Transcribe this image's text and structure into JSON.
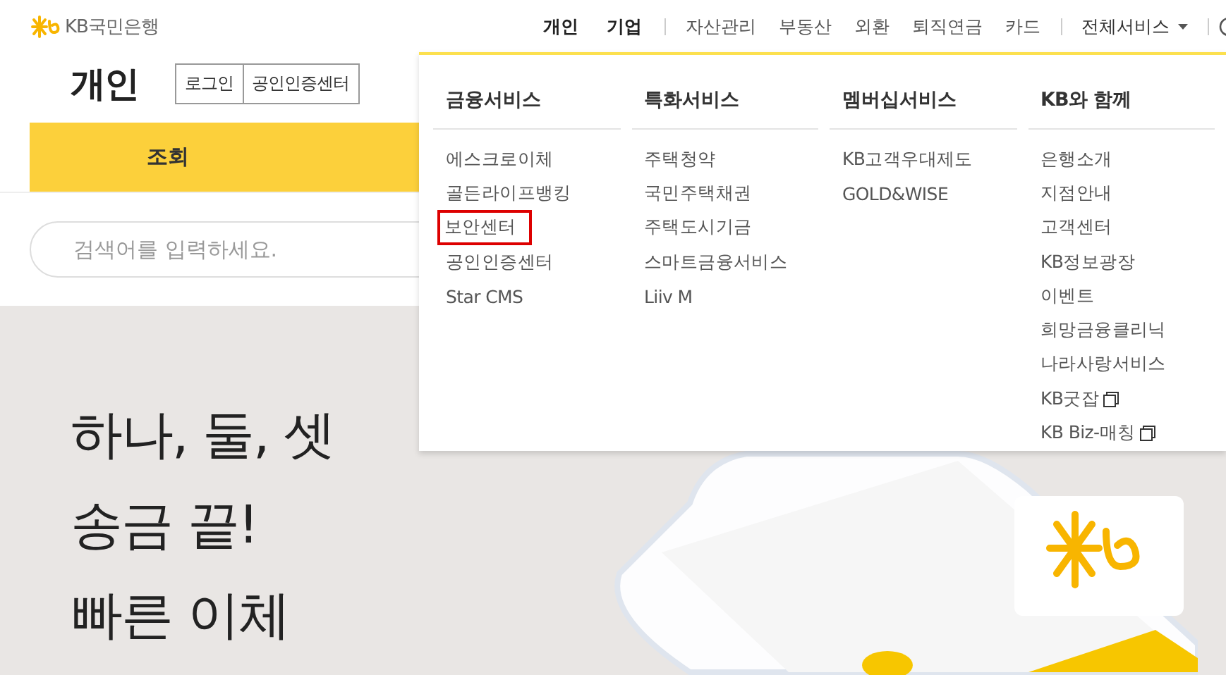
{
  "header": {
    "logo": "KB국민은행",
    "nav": [
      {
        "label": "개인",
        "kind": "primary"
      },
      {
        "label": "기업",
        "kind": "primary"
      },
      {
        "label": "자산관리",
        "kind": "secondary"
      },
      {
        "label": "부동산",
        "kind": "secondary"
      },
      {
        "label": "외환",
        "kind": "secondary"
      },
      {
        "label": "퇴직연금",
        "kind": "secondary"
      },
      {
        "label": "카드",
        "kind": "secondary"
      },
      {
        "label": "전체서비스",
        "kind": "menu"
      }
    ]
  },
  "page": {
    "title": "개인",
    "buttons": [
      "로그인",
      "공인인증센터"
    ],
    "tabs": [
      {
        "label": "조회",
        "selected": true
      }
    ],
    "search": {
      "placeholder": "검색어를 입력하세요."
    }
  },
  "hero": {
    "lines": [
      "하나, 둘, 셋",
      "송금 끝!",
      "빠른 이체"
    ]
  },
  "menu": {
    "columns": [
      {
        "title": "금융서비스",
        "items": [
          {
            "label": "에스크로이체",
            "highlighted": false,
            "external": false
          },
          {
            "label": "골든라이프뱅킹",
            "highlighted": false,
            "external": false
          },
          {
            "label": "보안센터",
            "highlighted": true,
            "external": false
          },
          {
            "label": "공인인증센터",
            "highlighted": false,
            "external": false
          },
          {
            "label": "Star CMS",
            "highlighted": false,
            "external": false
          }
        ]
      },
      {
        "title": "특화서비스",
        "items": [
          {
            "label": "주택청약",
            "highlighted": false,
            "external": false
          },
          {
            "label": "국민주택채권",
            "highlighted": false,
            "external": false
          },
          {
            "label": "주택도시기금",
            "highlighted": false,
            "external": false
          },
          {
            "label": "스마트금융서비스",
            "highlighted": false,
            "external": false
          },
          {
            "label": "Liiv M",
            "highlighted": false,
            "external": false
          }
        ]
      },
      {
        "title": "멤버십서비스",
        "items": [
          {
            "label": "KB고객우대제도",
            "highlighted": false,
            "external": false
          },
          {
            "label": "GOLD&WISE",
            "highlighted": false,
            "external": false
          }
        ]
      },
      {
        "title": "KB와 함께",
        "items": [
          {
            "label": "은행소개",
            "highlighted": false,
            "external": false
          },
          {
            "label": "지점안내",
            "highlighted": false,
            "external": false
          },
          {
            "label": "고객센터",
            "highlighted": false,
            "external": false
          },
          {
            "label": "KB정보광장",
            "highlighted": false,
            "external": false
          },
          {
            "label": "이벤트",
            "highlighted": false,
            "external": false
          },
          {
            "label": "희망금융클리닉",
            "highlighted": false,
            "external": false
          },
          {
            "label": "나라사랑서비스",
            "highlighted": false,
            "external": false
          },
          {
            "label": "KB굿잡",
            "highlighted": false,
            "external": true
          },
          {
            "label": "KB Biz-매칭",
            "highlighted": false,
            "external": true
          }
        ]
      }
    ]
  }
}
